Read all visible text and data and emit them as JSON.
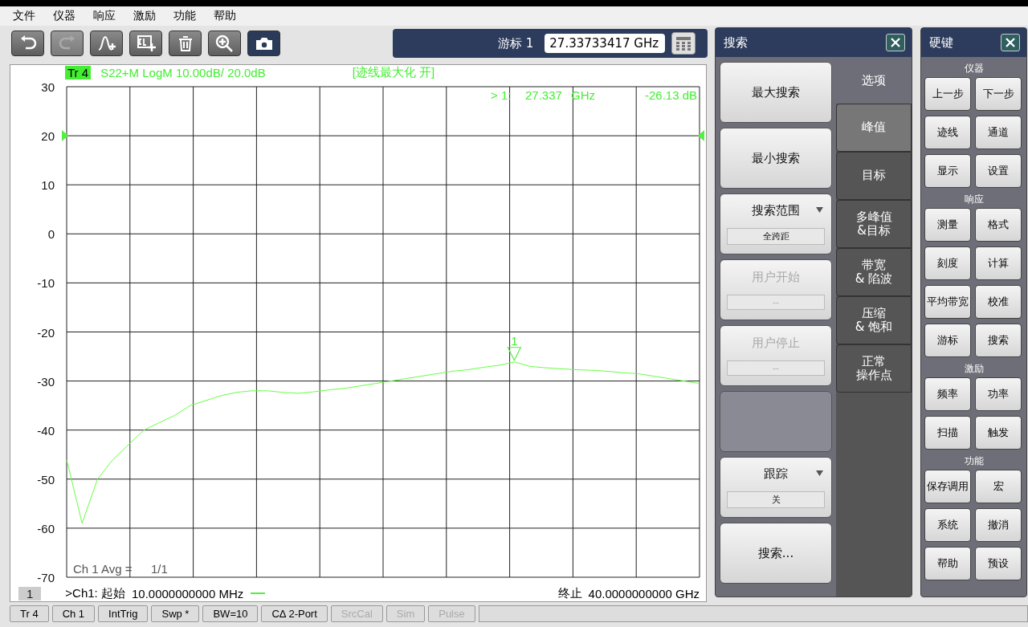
{
  "menu": [
    "文件",
    "仪器",
    "响应",
    "激励",
    "功能",
    "帮助"
  ],
  "toolbar": [
    {
      "kind": "undo",
      "disabled": false,
      "selected": false
    },
    {
      "kind": "redo",
      "disabled": true,
      "selected": false
    },
    {
      "kind": "add-trace",
      "disabled": false,
      "selected": false
    },
    {
      "kind": "add-channel",
      "disabled": false,
      "selected": false
    },
    {
      "kind": "delete",
      "disabled": false,
      "selected": false
    },
    {
      "kind": "zoom",
      "disabled": false,
      "selected": false
    },
    {
      "kind": "camera",
      "disabled": false,
      "selected": true
    }
  ],
  "marker_bar": {
    "label": "游标 1",
    "value": "27.33733417 GHz"
  },
  "plot": {
    "trace_badge": "Tr 4",
    "trace_info": "S22+M LogM 10.00dB/  20.0dB",
    "status": "[迹线最大化 开]",
    "marker_readout": {
      "id": "> 1:",
      "freq": "27.337",
      "unit": "GHz",
      "value": "-26.13 dB"
    },
    "marker_label": "1",
    "avg_label": "Ch 1 Avg =",
    "avg_value": "1/1",
    "channel_number": "1",
    "start_label": ">Ch1:  起始",
    "start": "10.0000000000 MHz",
    "stop_label": "终止",
    "stop": "40.0000000000 GHz",
    "chart_data": {
      "type": "line",
      "grid": true,
      "ylim": [
        -70,
        30
      ],
      "yticks": [
        30,
        20,
        10,
        0,
        -10,
        -20,
        -30,
        -40,
        -50,
        -60,
        -70
      ],
      "series": [
        {
          "color": "#66ff44",
          "values": [
            -46,
            -59,
            -50,
            -46,
            -43,
            -40,
            -38.5,
            -37,
            -35,
            -34,
            -33,
            -32.3,
            -32,
            -32,
            -32.3,
            -32.5,
            -32.2,
            -31.8,
            -31.5,
            -31,
            -30.5,
            -30,
            -29.5,
            -29,
            -28.5,
            -28,
            -27.7,
            -27.2,
            -26.8,
            -26.1,
            -27,
            -27.3,
            -27.5,
            -27.7,
            -27.8,
            -28,
            -28.3,
            -28.5,
            -29,
            -29.5,
            -30,
            -30.5
          ]
        }
      ]
    }
  },
  "search_panel": {
    "title": "搜索",
    "options_label": "选项",
    "buttons": [
      {
        "kind": "button",
        "label": "最大搜索",
        "disabled": false
      },
      {
        "kind": "button",
        "label": "最小搜索",
        "disabled": false
      },
      {
        "kind": "dropdown",
        "label": "搜索范围",
        "value": "全跨距",
        "disabled": false
      },
      {
        "kind": "field",
        "label": "用户开始",
        "value": "--",
        "disabled": true
      },
      {
        "kind": "field",
        "label": "用户停止",
        "value": "--",
        "disabled": true
      },
      {
        "kind": "blank"
      },
      {
        "kind": "dropdown",
        "label": "跟踪",
        "value": "关",
        "disabled": false
      },
      {
        "kind": "button",
        "label": "搜索...",
        "disabled": false
      }
    ],
    "tabs": [
      {
        "lines": [
          "峰值"
        ],
        "selected": true
      },
      {
        "lines": [
          "目标"
        ],
        "selected": false
      },
      {
        "lines": [
          "多峰值",
          "&目标"
        ],
        "selected": false
      },
      {
        "lines": [
          "带宽",
          "& 陷波"
        ],
        "selected": false
      },
      {
        "lines": [
          "压缩",
          "& 饱和"
        ],
        "selected": false
      },
      {
        "lines": [
          "正常",
          "操作点"
        ],
        "selected": false
      }
    ]
  },
  "hardkeys": {
    "title": "硬键",
    "groups": [
      {
        "title": "仪器",
        "keys": [
          "上一步",
          "下一步",
          "迹线",
          "通道",
          "显示",
          "设置"
        ]
      },
      {
        "title": "响应",
        "keys": [
          "测量",
          "格式",
          "刻度",
          "计算",
          "平均带宽",
          "校准",
          "游标",
          "搜索"
        ]
      },
      {
        "title": "激励",
        "keys": [
          "频率",
          "功率",
          "扫描",
          "触发"
        ]
      },
      {
        "title": "功能",
        "keys": [
          "保存调用",
          "宏",
          "系统",
          "撤消",
          "帮助",
          "预设"
        ]
      }
    ]
  },
  "status_bar": [
    {
      "label": "Tr 4",
      "disabled": false
    },
    {
      "label": "Ch 1",
      "disabled": false
    },
    {
      "label": "IntTrig",
      "disabled": false
    },
    {
      "label": "Swp *",
      "disabled": false
    },
    {
      "label": "BW=10",
      "disabled": false
    },
    {
      "label": "CΔ 2-Port",
      "disabled": false
    },
    {
      "label": "SrcCal",
      "disabled": true
    },
    {
      "label": "Sim",
      "disabled": true
    },
    {
      "label": "Pulse",
      "disabled": true
    }
  ]
}
